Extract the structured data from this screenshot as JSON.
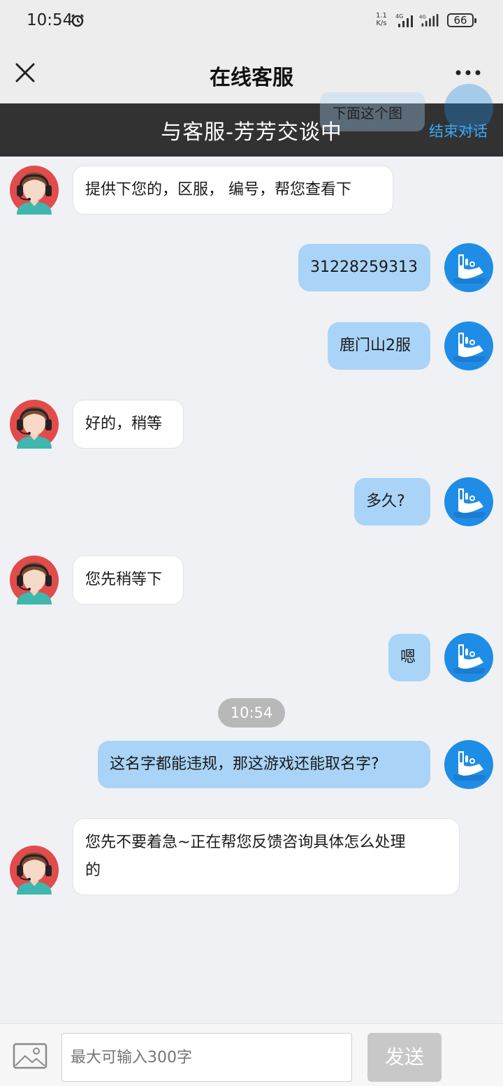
{
  "status_bar": {
    "time": "10:54",
    "net_speed_top": "1.1",
    "net_speed_unit": "K/s",
    "battery": "66"
  },
  "header": {
    "title": "在线客服",
    "close_icon": "close-icon",
    "more_icon": "more-dots-icon"
  },
  "banner": {
    "label": "与客服-芳芳交谈中",
    "end_label": "结束对话",
    "peek_text": "下面这个图"
  },
  "messages": [
    {
      "from": "agent",
      "text": "提供下您的，区服， 编号，帮您查看下"
    },
    {
      "from": "user",
      "text": "31228259313"
    },
    {
      "from": "user",
      "text": "鹿门山2服"
    },
    {
      "from": "agent",
      "text": "好的，稍等"
    },
    {
      "from": "user",
      "text": "多久?"
    },
    {
      "from": "agent",
      "text": "您先稍等下"
    },
    {
      "from": "user",
      "text": "嗯"
    },
    {
      "from": "time",
      "text": "10:54"
    },
    {
      "from": "user",
      "text": "这名字都能违规，那这游戏还能取名字?"
    },
    {
      "from": "agent",
      "text_line1": "您先不要着急~正在帮您反馈咨询具体怎么处理",
      "text_line2": "的"
    }
  ],
  "input": {
    "placeholder": "最大可输入300字",
    "send_label": "发送",
    "image_icon": "image-icon"
  },
  "colors": {
    "user_bubble": "#a9d4f7",
    "agent_bubble": "#ffffff",
    "banner_bg": "#222222",
    "end_link": "#3ea8f5",
    "user_avatar": "#1f8de6"
  }
}
